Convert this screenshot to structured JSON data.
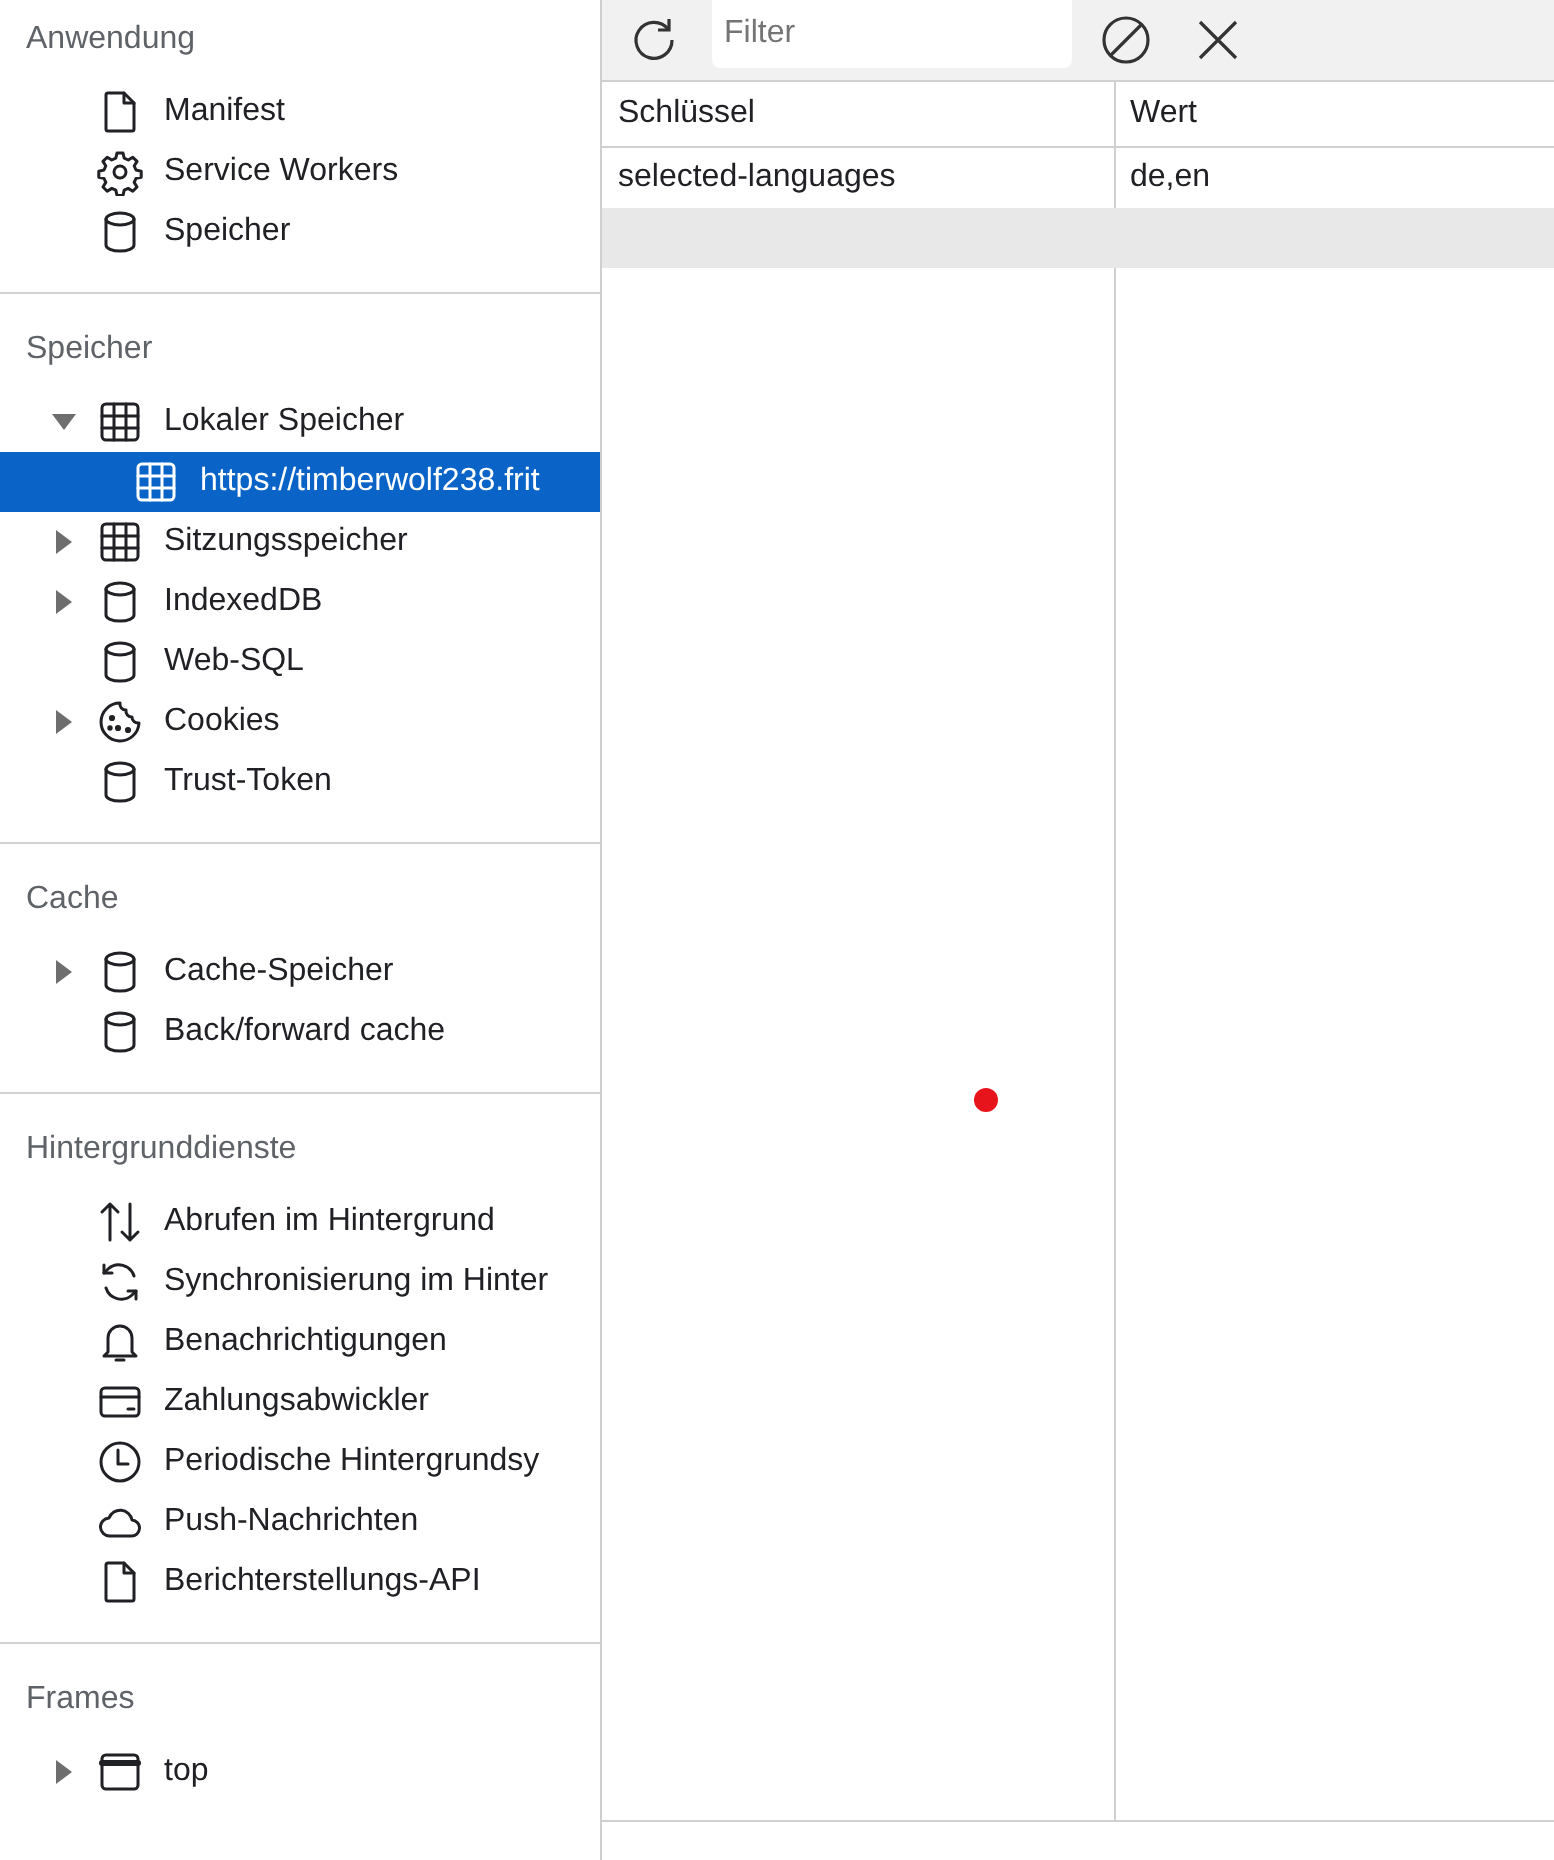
{
  "sidebar": {
    "sections": [
      {
        "title": "Anwendung",
        "items": [
          {
            "label": "Manifest",
            "kind": "file",
            "selected": false
          },
          {
            "label": "Service Workers",
            "kind": "gear",
            "selected": false
          },
          {
            "label": "Speicher",
            "kind": "cylinder",
            "selected": false
          }
        ]
      },
      {
        "title": "Speicher",
        "items": [
          {
            "label": "Lokaler Speicher",
            "kind": "grid",
            "expanded": true,
            "selected": false,
            "children": [
              {
                "label": "https://timberwolf238.frit",
                "kind": "grid",
                "selected": true
              }
            ]
          },
          {
            "label": "Sitzungsspeicher",
            "kind": "grid",
            "expanded": false,
            "selected": false
          },
          {
            "label": "IndexedDB",
            "kind": "cylinder",
            "expanded": false,
            "selected": false
          },
          {
            "label": "Web-SQL",
            "kind": "cylinder",
            "selected": false
          },
          {
            "label": "Cookies",
            "kind": "cookie",
            "expanded": false,
            "selected": false
          },
          {
            "label": "Trust-Token",
            "kind": "cylinder",
            "selected": false
          }
        ]
      },
      {
        "title": "Cache",
        "items": [
          {
            "label": "Cache-Speicher",
            "kind": "cylinder",
            "expanded": false,
            "selected": false
          },
          {
            "label": "Back/forward cache",
            "kind": "cylinder",
            "selected": false
          }
        ]
      },
      {
        "title": "Hintergrunddienste",
        "items": [
          {
            "label": "Abrufen im Hintergrund",
            "kind": "updown",
            "selected": false
          },
          {
            "label": "Synchronisierung im Hinter",
            "kind": "sync",
            "selected": false
          },
          {
            "label": "Benachrichtigungen",
            "kind": "bell",
            "selected": false
          },
          {
            "label": "Zahlungsabwickler",
            "kind": "card",
            "selected": false
          },
          {
            "label": "Periodische Hintergrundsy",
            "kind": "clock",
            "selected": false
          },
          {
            "label": "Push-Nachrichten",
            "kind": "cloud",
            "selected": false
          },
          {
            "label": "Berichterstellungs-API",
            "kind": "file",
            "selected": false
          }
        ]
      },
      {
        "title": "Frames",
        "items": [
          {
            "label": "top",
            "kind": "window",
            "expanded": false,
            "selected": false
          }
        ]
      }
    ]
  },
  "toolbar": {
    "filter": {
      "placeholder": "Filter"
    }
  },
  "table": {
    "columns": [
      "Schlüssel",
      "Wert"
    ],
    "rows": [
      [
        "selected-languages",
        "de,en"
      ]
    ]
  }
}
